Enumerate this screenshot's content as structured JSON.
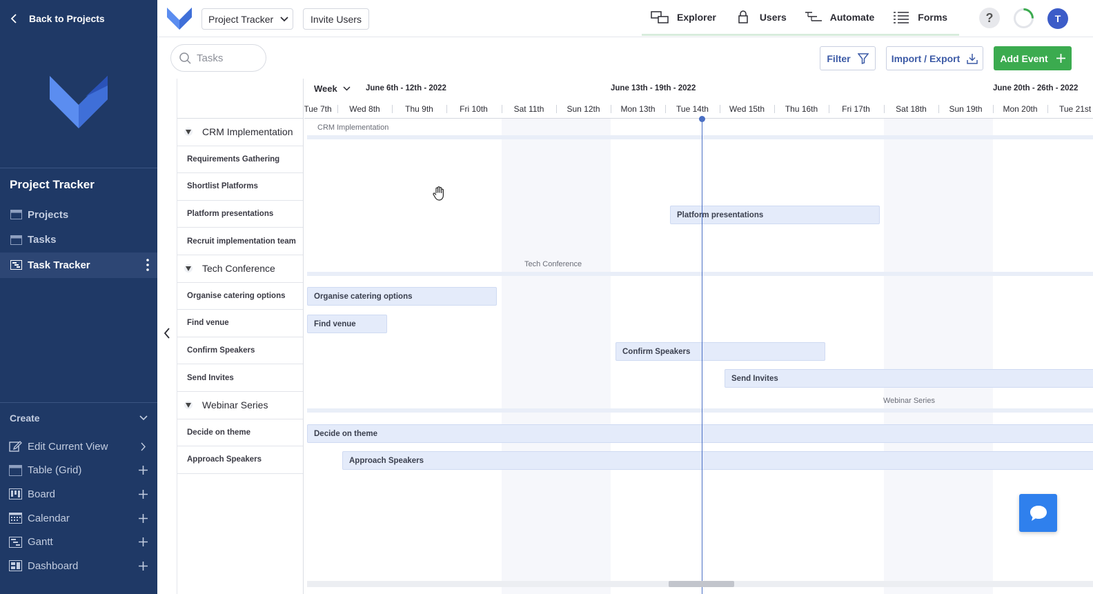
{
  "sidebar": {
    "back_label": "Back to Projects",
    "project_title": "Project Tracker",
    "nav": [
      {
        "label": "Projects",
        "icon": "table-icon"
      },
      {
        "label": "Tasks",
        "icon": "table-icon"
      },
      {
        "label": "Task Tracker",
        "icon": "gantt-icon",
        "active": true
      }
    ],
    "create_label": "Create",
    "create_items": [
      {
        "label": "Edit Current View",
        "icon": "edit-icon",
        "trail": "chevron-right-icon"
      },
      {
        "label": "Table (Grid)",
        "icon": "table-icon",
        "trail": "plus-icon"
      },
      {
        "label": "Board",
        "icon": "board-icon",
        "trail": "plus-icon"
      },
      {
        "label": "Calendar",
        "icon": "calendar-icon",
        "trail": "plus-icon"
      },
      {
        "label": "Gantt",
        "icon": "gantt-icon",
        "trail": "plus-icon"
      },
      {
        "label": "Dashboard",
        "icon": "dashboard-icon",
        "trail": "plus-icon"
      }
    ]
  },
  "topbar": {
    "project_dropdown": "Project Tracker",
    "invite_label": "Invite Users",
    "nav": [
      {
        "label": "Explorer",
        "icon": "explorer-icon"
      },
      {
        "label": "Users",
        "icon": "lock-icon"
      },
      {
        "label": "Automate",
        "icon": "automate-icon"
      },
      {
        "label": "Forms",
        "icon": "forms-icon"
      }
    ],
    "help_label": "?",
    "avatar_initial": "T"
  },
  "toolbar": {
    "search_placeholder": "Tasks",
    "filter_label": "Filter",
    "import_label": "Import / Export",
    "add_label": "Add Event"
  },
  "tasklist": {
    "rows": [
      {
        "label": "CRM Implementation",
        "group": true
      },
      {
        "label": "Requirements Gathering"
      },
      {
        "label": "Shortlist Platforms"
      },
      {
        "label": "Platform presentations"
      },
      {
        "label": "Recruit implementation team"
      },
      {
        "label": "Tech Conference",
        "group": true
      },
      {
        "label": "Organise catering options"
      },
      {
        "label": "Find venue"
      },
      {
        "label": "Confirm Speakers"
      },
      {
        "label": "Send Invites"
      },
      {
        "label": "Webinar Series",
        "group": true
      },
      {
        "label": "Decide on theme"
      },
      {
        "label": "Approach Speakers"
      }
    ]
  },
  "gantt": {
    "scale_label": "Week",
    "ranges": [
      "June 6th - 12th - 2022",
      "June 13th - 19th - 2022",
      "June 20th - 26th - 2022"
    ],
    "days": [
      "Tue 7th",
      "Wed 8th",
      "Thu 9th",
      "Fri 10th",
      "Sat 11th",
      "Sun 12th",
      "Mon 13th",
      "Tue 14th",
      "Wed 15th",
      "Thu 16th",
      "Fri 17th",
      "Sat 18th",
      "Sun 19th",
      "Mon 20th",
      "Tue 21st"
    ],
    "groups": [
      "CRM Implementation",
      "Tech Conference",
      "Webinar Series"
    ],
    "bars": [
      "Platform presentations",
      "Organise catering options",
      "Find venue",
      "Confirm Speakers",
      "Send Invites",
      "Decide on theme",
      "Approach Speakers"
    ],
    "today": "Tue 14th"
  }
}
